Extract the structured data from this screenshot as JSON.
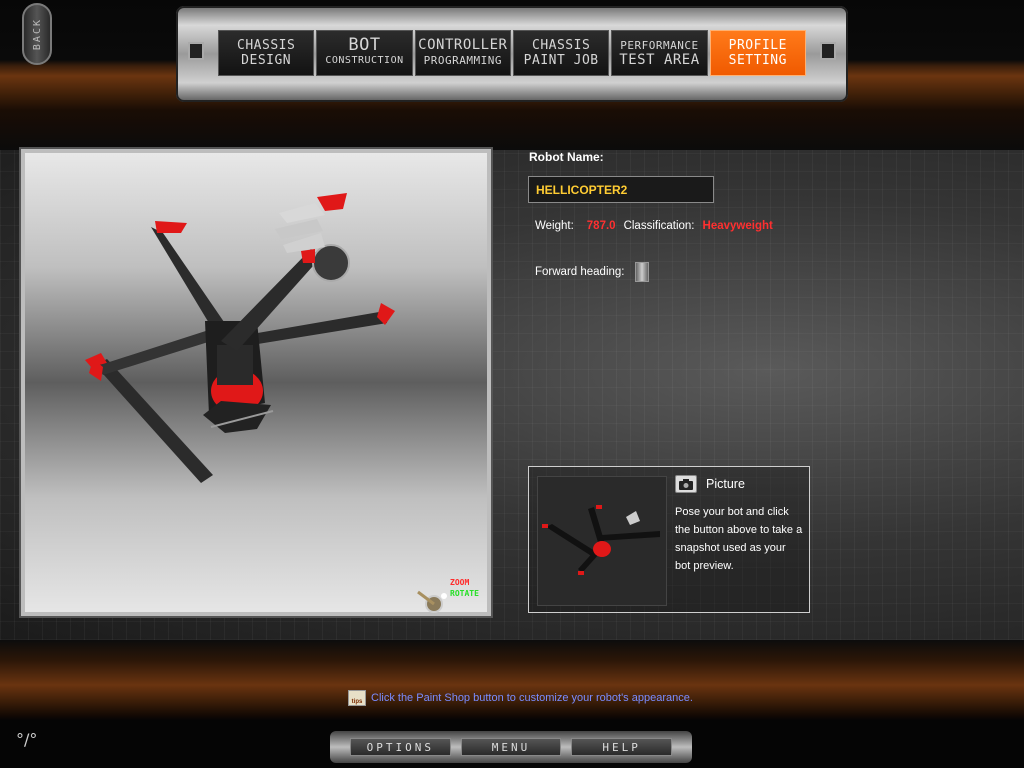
{
  "back_button": {
    "label": "BACK"
  },
  "nav_tabs": [
    {
      "line1": "CHASSIS",
      "line2": "DESIGN",
      "active": false
    },
    {
      "line1": "BOT",
      "line2": "CONSTRUCTION",
      "active": false
    },
    {
      "line1": "CONTROLLER",
      "line2": "PROGRAMMING",
      "active": false
    },
    {
      "line1": "CHASSIS",
      "line2": "PAINT JOB",
      "active": false
    },
    {
      "line1": "PERFORMANCE",
      "line2": "TEST AREA",
      "active": false
    },
    {
      "line1": "PROFILE",
      "line2": "SETTING",
      "active": true
    }
  ],
  "viewport": {
    "zoom_label": "ZOOM",
    "rotate_label": "ROTATE",
    "robot_colors": {
      "body": "#2a2a2a",
      "accent": "#e01818",
      "blade": "#d8d8d8"
    }
  },
  "profile": {
    "robot_name_label": "Robot Name:",
    "robot_name_value": "HELLICOPTER2",
    "weight_label": "Weight:",
    "weight_value": "787.0",
    "classification_label": "Classification:",
    "classification_value": "Heavyweight",
    "forward_heading_label": "Forward heading:"
  },
  "picture": {
    "title": "Picture",
    "help_text": "Pose your bot and click the button above to take a snapshot used as your bot preview."
  },
  "tip": {
    "icon_text": "tips",
    "text": "Click the Paint Shop button to customize your robot's appearance."
  },
  "bottom_menu": [
    {
      "label": "OPTIONS"
    },
    {
      "label": "MENU"
    },
    {
      "label": "HELP"
    }
  ],
  "corner_logo": "°/°",
  "colors": {
    "active_tab": "#f05a00",
    "name_text": "#ffcc33",
    "stat_value": "#ff3030",
    "tip_text": "#7a8cff"
  }
}
